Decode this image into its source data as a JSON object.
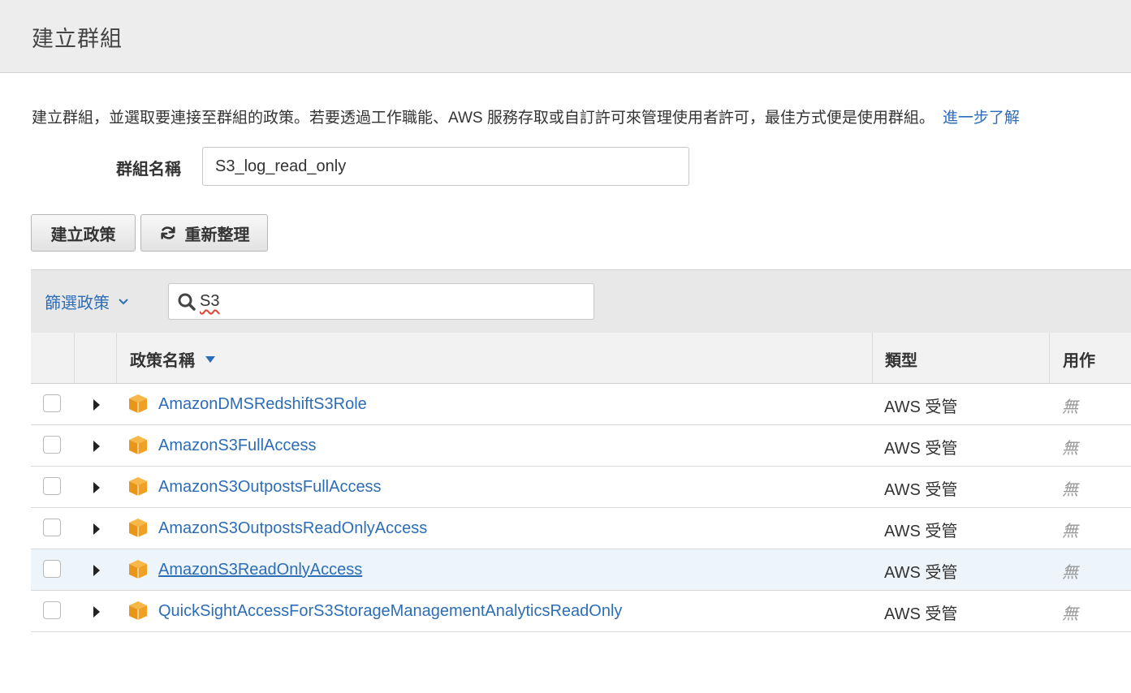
{
  "header": {
    "title": "建立群組"
  },
  "description": {
    "text": "建立群組，並選取要連接至群組的政策。若要透過工作職能、AWS 服務存取或自訂許可來管理使用者許可，最佳方式便是使用群組。",
    "learn_more": "進一步了解"
  },
  "group_name": {
    "label": "群組名稱",
    "value": "S3_log_read_only"
  },
  "toolbar": {
    "create_policy_label": "建立政策",
    "refresh_label": "重新整理"
  },
  "filter": {
    "dropdown_label": "篩選政策",
    "search_value": "S3"
  },
  "table": {
    "columns": {
      "name": "政策名稱",
      "type": "類型",
      "use": "用作"
    },
    "rows": [
      {
        "name": "AmazonDMSRedshiftS3Role",
        "type": "AWS 受管",
        "use": "無"
      },
      {
        "name": "AmazonS3FullAccess",
        "type": "AWS 受管",
        "use": "無"
      },
      {
        "name": "AmazonS3OutpostsFullAccess",
        "type": "AWS 受管",
        "use": "無"
      },
      {
        "name": "AmazonS3OutpostsReadOnlyAccess",
        "type": "AWS 受管",
        "use": "無"
      },
      {
        "name": "AmazonS3ReadOnlyAccess",
        "type": "AWS 受管",
        "use": "無"
      },
      {
        "name": "QuickSightAccessForS3StorageManagementAnalyticsReadOnly",
        "type": "AWS 受管",
        "use": "無"
      }
    ]
  },
  "colors": {
    "link": "#2c6db5",
    "cube": "#f0a024",
    "hover_row": "#eef5fa"
  },
  "icons": {
    "refresh": "refresh-icon",
    "search": "search-icon",
    "policy": "policy-cube-icon"
  }
}
